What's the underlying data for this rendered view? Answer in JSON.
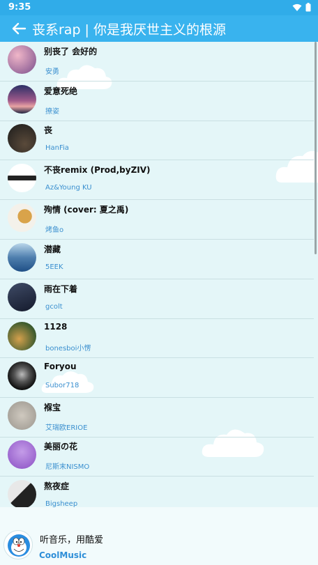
{
  "status_bar": {
    "time": "9:35"
  },
  "app_bar": {
    "title": "丧系rap | 你是我厌世主义的根源"
  },
  "songs": [
    {
      "title": "别丧了 会好的",
      "artist": "安勇",
      "art_colors": [
        "#7a4e8c",
        "#f0b6c8"
      ]
    },
    {
      "title": "爱意死绝",
      "artist": "撩姿",
      "art_colors": [
        "#2b2f66",
        "#e8a3a3"
      ]
    },
    {
      "title": "丧",
      "artist": "HanFia",
      "art_colors": [
        "#1b1b1b",
        "#5a4a3a"
      ]
    },
    {
      "title": "不丧remix (Prod,byZIV)",
      "artist": "Az&Young KU",
      "art_colors": [
        "#ffffff",
        "#222222"
      ]
    },
    {
      "title": "殉情 (cover: 夏之禹)",
      "artist": "烤鱼o",
      "art_colors": [
        "#f4f1ea",
        "#d9a34a"
      ]
    },
    {
      "title": "潜藏",
      "artist": "5EEK",
      "art_colors": [
        "#1f4f86",
        "#b9d6ea"
      ]
    },
    {
      "title": "雨在下着",
      "artist": "gcolt",
      "art_colors": [
        "#141a2c",
        "#3f4b66"
      ]
    },
    {
      "title": "1128",
      "artist": "bonesboi小愣",
      "art_colors": [
        "#3d5b2e",
        "#d4a04c"
      ]
    },
    {
      "title": "Foryou",
      "artist": "Subor718",
      "art_colors": [
        "#111111",
        "#bbbbbb"
      ]
    },
    {
      "title": "褓宝",
      "artist": "艾瑞欧ERIOE",
      "art_colors": [
        "#9a958d",
        "#cfc9bf"
      ]
    },
    {
      "title": "美丽の花",
      "artist": "尼斯末NISMO",
      "art_colors": [
        "#8a4fc4",
        "#c49ce8"
      ]
    },
    {
      "title": "熬夜症",
      "artist": "Bigsheep",
      "art_colors": [
        "#e8e8e8",
        "#222222"
      ]
    }
  ],
  "footer": {
    "slogan": "听音乐，用酷爱",
    "brand": "CoolMusic"
  },
  "colors": {
    "status_bar": "#30ace9",
    "app_bar": "#39b3ee",
    "background": "#e4f6f8",
    "artist_text": "#3a8fcf",
    "brand": "#2f8fd8"
  }
}
